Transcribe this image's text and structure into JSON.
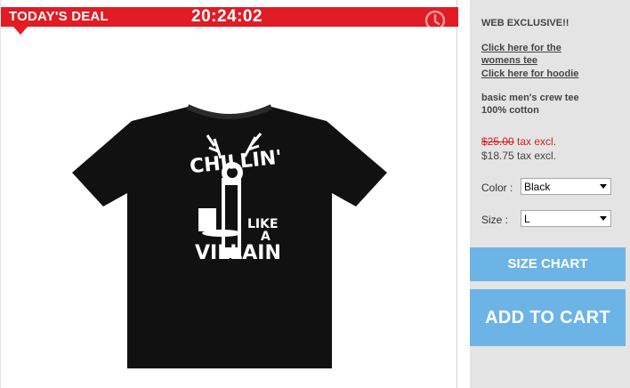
{
  "deal": {
    "label": "TODAY'S DEAL",
    "timer": "20:24:02",
    "accent_color": "#e11c24",
    "icon": "clock-icon"
  },
  "product": {
    "image_text": {
      "line1": "CHILLIN'",
      "line2": "LIKE",
      "line3": "A",
      "line4": "VILLAIN"
    }
  },
  "options": {
    "web_exclusive": "WEB EXCLUSIVE!!",
    "link_womens": "Click here for the womens tee",
    "link_hoodie": "Click here for hoodie",
    "desc_line1": "basic men's crew tee",
    "desc_line2": "100% cotton",
    "old_price": "$25.00",
    "old_price_suffix": " tax excl.",
    "new_price": "$18.75 tax excl.",
    "color_label": "Color :",
    "color_value": "Black",
    "size_label": "Size :",
    "size_value": "L",
    "size_chart_label": "SIZE CHART",
    "add_to_cart_label": "ADD TO CART",
    "button_color": "#6db4e6"
  }
}
